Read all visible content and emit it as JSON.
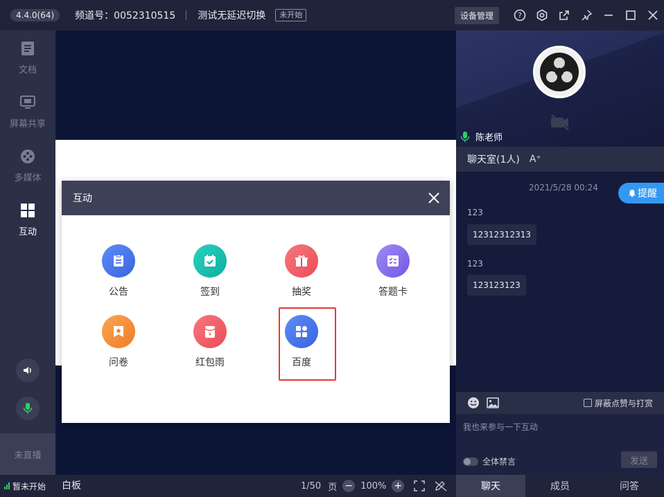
{
  "topbar": {
    "version": "4.4.0(64)",
    "channel": "频道号：0052310515",
    "room_title": "测试无延迟切换",
    "status": "未开始",
    "device_btn": "设备管理"
  },
  "sidebar": {
    "items": [
      {
        "label": "文档",
        "icon": "document-icon"
      },
      {
        "label": "屏幕共享",
        "icon": "screen-share-icon"
      },
      {
        "label": "多媒体",
        "icon": "media-icon"
      },
      {
        "label": "互动",
        "icon": "grid-icon"
      }
    ],
    "live_state": "未直播"
  },
  "dialog": {
    "title": "互动",
    "tools": [
      {
        "label": "公告",
        "icon": "announcement-icon",
        "color": "#4f7ff0"
      },
      {
        "label": "签到",
        "icon": "checkin-icon",
        "color": "#16c0b1"
      },
      {
        "label": "抽奖",
        "icon": "lottery-icon",
        "color": "#f2646b"
      },
      {
        "label": "答题卡",
        "icon": "answer-card-icon",
        "color": "#8a72ef"
      },
      {
        "label": "问卷",
        "icon": "questionnaire-icon",
        "color": "#f7913c"
      },
      {
        "label": "红包雨",
        "icon": "red-packet-icon",
        "color": "#f2646b"
      },
      {
        "label": "百度",
        "icon": "baidu-app-icon",
        "color": "#4f7ff0"
      }
    ]
  },
  "bottombar": {
    "status": "暂未开始",
    "whiteboard": "白板",
    "page": "1/50",
    "page_unit": "页",
    "zoom": "100%",
    "tabs": [
      "聊天",
      "成员",
      "问答"
    ]
  },
  "video": {
    "teacher": "陈老师"
  },
  "chat": {
    "header": "聊天室(1人)",
    "font_btn": "A⁺",
    "timestamp": "2021/5/28 00:24",
    "remind": "提醒",
    "messages": [
      {
        "sender": "123",
        "text": "12312312313"
      },
      {
        "sender": "123",
        "text": "123123123"
      }
    ],
    "shield_label": "屏蔽点赞与打赏",
    "input_placeholder": "我也来参与一下互动",
    "mute_all": "全体禁言",
    "send": "发送"
  },
  "colors": {
    "accent": "#3398f3",
    "highlight": "#e23a3a",
    "signal": "#2fcf63"
  }
}
